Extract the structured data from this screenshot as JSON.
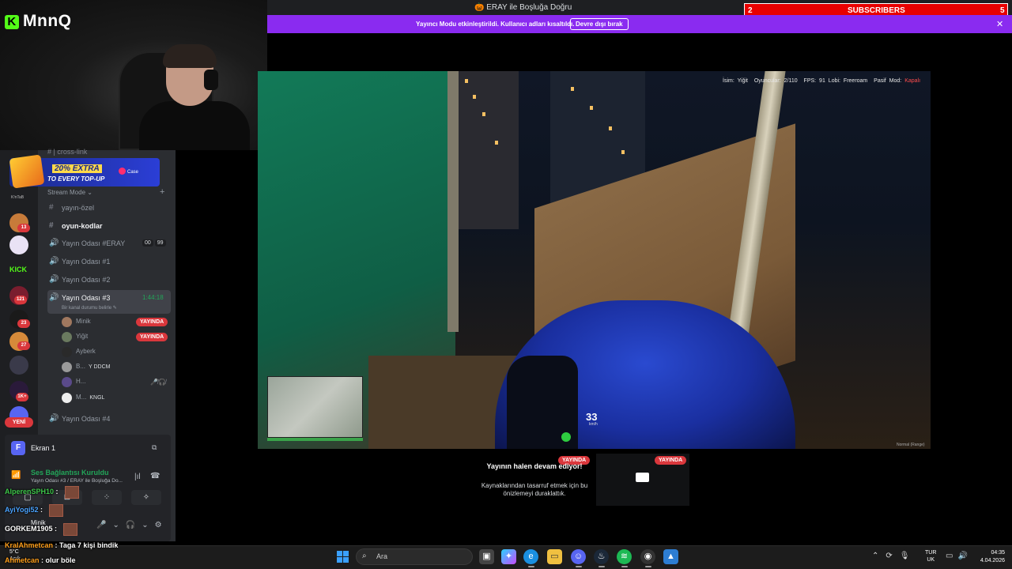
{
  "window": {
    "title": "ERAY ile Boşluğa Doğru"
  },
  "banner": {
    "text": "Yayıncı Modu etkinleştirildi. Kullanıcı adları kısaltıldı.",
    "button_label": "Devre dışı bırak",
    "close": "✕"
  },
  "overlay": {
    "logo_text": "MnnQ",
    "subs_count": "2",
    "subs_label": "SUBSCRIBERS",
    "subs_goal": "5"
  },
  "game_hud": {
    "isim_label": "İsim:",
    "isim_value": "Yiğit",
    "oyuncular": "Oyuncular: 2/110",
    "fps": "FPS: 91",
    "lobi": "Lobi: Freeroam",
    "pasif_label": "Pasif Mod:",
    "pasif_value": "Kapalı",
    "speed": "33",
    "speed_unit": "km/h",
    "watermark": "Normal (Range)"
  },
  "stream_tiles": [
    {
      "badge": "YAYINDA",
      "title": "Yayının halen devam ediyor!",
      "desc": "Kaynaklarından tasarruf etmek için bu önizlemeyi duraklattık."
    },
    {
      "badge": "YAYINDA"
    }
  ],
  "ad": {
    "line1": "20% EXTRA",
    "line2": "TO EVERY TOP-UP",
    "brand": "Case"
  },
  "servers": {
    "kick_label": "KICK",
    "small_label": "K!nTaB",
    "badges": [
      "13",
      "121",
      "23",
      "27",
      "1K+"
    ],
    "new_label": "YENİ"
  },
  "channels": {
    "crosslink": "cross-link",
    "stream_mode": "Stream Mode",
    "items": [
      {
        "label": "yayın-özel",
        "glyph": "#"
      },
      {
        "label": "oyun-kodlar",
        "glyph": "#"
      },
      {
        "label": "Yayın Odası #ERAY",
        "glyph": "🔊"
      },
      {
        "label": "Yayın Odası #1",
        "glyph": "🔊"
      },
      {
        "label": "Yayın Odası #2",
        "glyph": "🔊"
      },
      {
        "label": "Yayın Odası #3",
        "glyph": "🔊"
      },
      {
        "label": "Yayın Odası #4",
        "glyph": "🔊"
      }
    ],
    "counts": [
      "00",
      "99"
    ],
    "active_timer": "1:44:18",
    "active_status": "Bir kanal durumu belirle ✎",
    "members": [
      {
        "name": "Minik",
        "tag": ""
      },
      {
        "name": "Yiğit",
        "tag": ""
      },
      {
        "name": "Ayberk",
        "tag": ""
      },
      {
        "name": "B...",
        "tag": "Y DDCM"
      },
      {
        "name": "H...",
        "tag": ""
      },
      {
        "name": "M...",
        "tag": "KNGL"
      }
    ],
    "member_badge": "YAYINDA"
  },
  "voice": {
    "screen_label": "Ekran 1",
    "screen_icon": "F",
    "status": "Ses Bağlantısı Kuruldu",
    "sub": "Yayın Odası #3 / ERAY ile Boşluğa Do...",
    "user_name": "Minik"
  },
  "chat": [
    {
      "user": "AlperenSPH10",
      "text": " :",
      "color": "#3ec74a"
    },
    {
      "user": "AyiYogi52",
      "text": " :",
      "color": "#4aa3ff"
    },
    {
      "user": "GORKEM1905",
      "text": " :",
      "color": "#ffffff"
    },
    {
      "user": "KralAhmetcan",
      "text": " : Taga 7 kişi bindik",
      "color": "#ff9f1a"
    },
    {
      "user": "Ahmetcan",
      "text": " : olur böle",
      "color": "#ff9f1a"
    }
  ],
  "weather": {
    "temp": "5°C",
    "desc": "Açık"
  },
  "taskbar": {
    "search_placeholder": "Ara",
    "lang_line1": "TUR",
    "lang_line2": "UK",
    "time": "04:35",
    "date": "4.04.2026"
  }
}
